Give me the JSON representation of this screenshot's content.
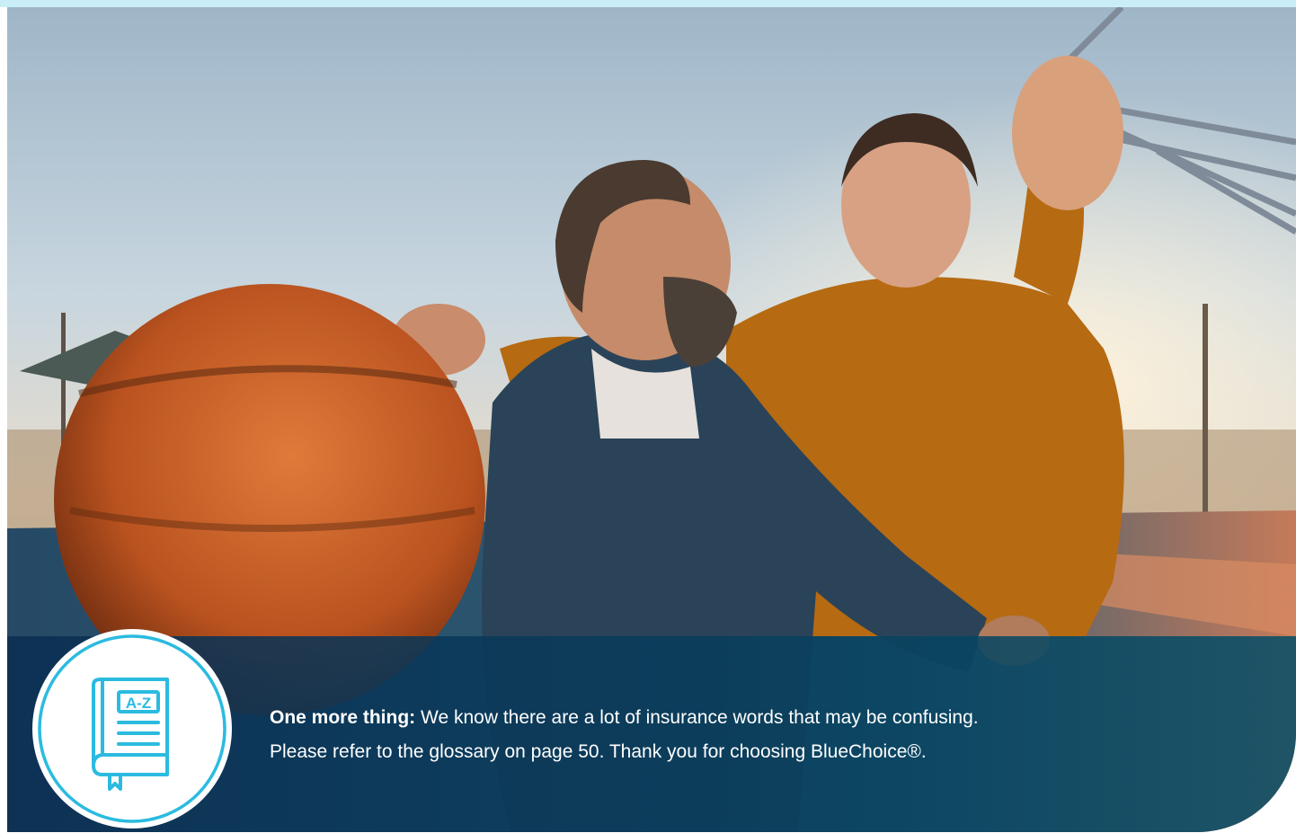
{
  "photo": {
    "alt_subject": "father and son playing basketball outdoors"
  },
  "callout": {
    "lead": "One more thing:",
    "line1_rest": " We know there are a lot of insurance words that may be confusing.",
    "line2": "Please refer to the glossary on page 50. Thank you for choosing BlueChoice®."
  },
  "badge": {
    "icon": "glossary-book-icon",
    "label": "A-Z"
  },
  "colors": {
    "accent": "#2bbbe0",
    "banner": "#0a3a5a",
    "top_band": "#c9eef8"
  }
}
